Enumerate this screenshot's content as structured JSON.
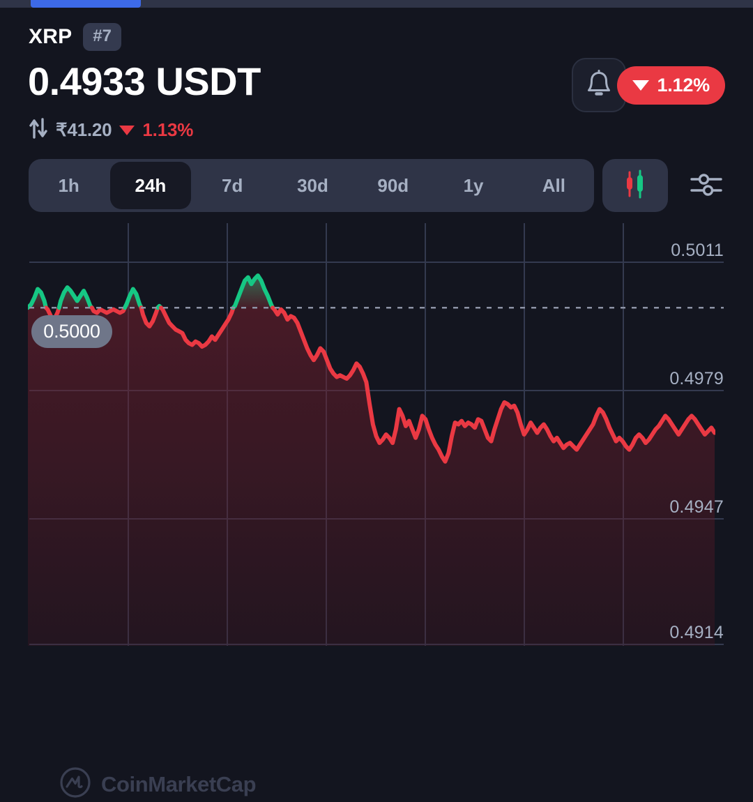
{
  "topbar": {
    "segment_color": "#3d6ae8",
    "track_color": "#2f3447"
  },
  "header": {
    "symbol": "XRP",
    "rank_badge": "#7",
    "price": "0.4933 USDT",
    "fiat_price": "₹41.20",
    "fiat_change": "1.13%",
    "change_pill": "1.12%",
    "change_direction": "down",
    "bell_icon": "bell-icon",
    "updown_icon": "up-down-arrows-icon",
    "down_triangle_icon": "triangle-down-icon",
    "accent_down": "#ea3943",
    "accent_up": "#16c784"
  },
  "range_selector": {
    "tabs": [
      {
        "label": "1h",
        "active": false
      },
      {
        "label": "24h",
        "active": true
      },
      {
        "label": "7d",
        "active": false
      },
      {
        "label": "30d",
        "active": false
      },
      {
        "label": "90d",
        "active": false
      },
      {
        "label": "1y",
        "active": false
      },
      {
        "label": "All",
        "active": false
      }
    ],
    "candle_toggle_icon": "candlestick-icon",
    "settings_icon": "sliders-icon"
  },
  "chart_data": {
    "type": "line",
    "title": "",
    "xlabel": "",
    "ylabel": "",
    "yticks": [
      "0.5011",
      "0.4979",
      "0.4947",
      "0.4914"
    ],
    "ytick_values": [
      0.5011,
      0.4979,
      0.4947,
      0.4914
    ],
    "ylim": [
      0.49,
      0.5025
    ],
    "grid": true,
    "legend": "none",
    "reference_line": {
      "label": "0.5000",
      "value": 0.5
    },
    "line_color_up": "#16c784",
    "line_color_down": "#ea3943",
    "area_fill_down": "#3a1d2b",
    "watermark": "CoinMarketCap",
    "series": [
      {
        "name": "XRP/USDT",
        "values": [
          0.5,
          0.5001,
          0.5003,
          0.50055,
          0.50045,
          0.5002,
          0.49995,
          0.49975,
          0.49965,
          0.49985,
          0.5002,
          0.50045,
          0.5006,
          0.5005,
          0.50035,
          0.5002,
          0.50035,
          0.5005,
          0.5003,
          0.50005,
          0.4999,
          0.49985,
          0.49995,
          0.4999,
          0.49985,
          0.4999,
          0.49995,
          0.4999,
          0.49985,
          0.4999,
          0.5001,
          0.50035,
          0.50055,
          0.5004,
          0.5001,
          0.4998,
          0.49955,
          0.49945,
          0.4996,
          0.49985,
          0.50005,
          0.49995,
          0.49975,
          0.49955,
          0.49945,
          0.49935,
          0.4993,
          0.49925,
          0.49905,
          0.49895,
          0.4989,
          0.499,
          0.49895,
          0.49885,
          0.4989,
          0.499,
          0.49915,
          0.49905,
          0.4992,
          0.49935,
          0.4995,
          0.49965,
          0.49985,
          0.50005,
          0.5003,
          0.50055,
          0.5008,
          0.5009,
          0.5007,
          0.50085,
          0.50095,
          0.5008,
          0.50055,
          0.50035,
          0.5001,
          0.49995,
          0.4998,
          0.49995,
          0.49985,
          0.49965,
          0.49975,
          0.4997,
          0.49955,
          0.4993,
          0.49905,
          0.4988,
          0.4986,
          0.49845,
          0.4986,
          0.4988,
          0.4987,
          0.49845,
          0.4982,
          0.49805,
          0.49795,
          0.498,
          0.49795,
          0.4979,
          0.498,
          0.49815,
          0.49835,
          0.49825,
          0.49805,
          0.4978,
          0.49715,
          0.49655,
          0.4962,
          0.496,
          0.4961,
          0.49625,
          0.49615,
          0.496,
          0.4964,
          0.497,
          0.4968,
          0.4965,
          0.49665,
          0.4964,
          0.49615,
          0.4964,
          0.4968,
          0.4967,
          0.4964,
          0.49615,
          0.49595,
          0.4958,
          0.4956,
          0.49545,
          0.4957,
          0.4962,
          0.4966,
          0.49655,
          0.49665,
          0.4965,
          0.4966,
          0.49655,
          0.49645,
          0.4967,
          0.49665,
          0.4964,
          0.49615,
          0.49605,
          0.4964,
          0.4967,
          0.497,
          0.4972,
          0.49715,
          0.49705,
          0.4971,
          0.4969,
          0.49655,
          0.49625,
          0.4964,
          0.4966,
          0.49645,
          0.4963,
          0.49645,
          0.49655,
          0.4964,
          0.4962,
          0.49605,
          0.49615,
          0.496,
          0.49585,
          0.49595,
          0.496,
          0.4959,
          0.4958,
          0.49595,
          0.4961,
          0.49625,
          0.4964,
          0.49655,
          0.4968,
          0.497,
          0.4969,
          0.4967,
          0.49645,
          0.49625,
          0.49605,
          0.49615,
          0.49605,
          0.4959,
          0.4958,
          0.49595,
          0.49615,
          0.49625,
          0.49615,
          0.496,
          0.4961,
          0.49625,
          0.4964,
          0.4965,
          0.49665,
          0.4968,
          0.4967,
          0.49655,
          0.4964,
          0.49625,
          0.4964,
          0.49655,
          0.4967,
          0.4968,
          0.4967,
          0.49655,
          0.4964,
          0.49625,
          0.49635,
          0.49645,
          0.4963
        ]
      }
    ]
  }
}
